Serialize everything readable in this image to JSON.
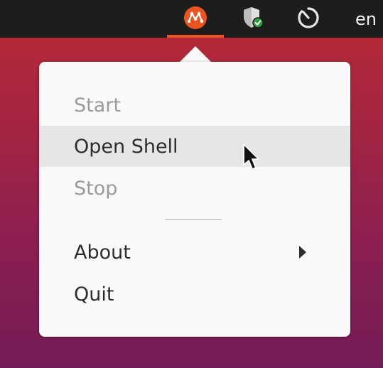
{
  "panel": {
    "indicators": [
      {
        "icon": "multipass-icon",
        "active": true,
        "accent": "#e95420"
      },
      {
        "icon": "shield-check-icon"
      },
      {
        "icon": "power-timer-icon"
      }
    ],
    "language": "en"
  },
  "menu": {
    "items": [
      {
        "label": "Start",
        "enabled": false
      },
      {
        "label": "Open Shell",
        "enabled": true,
        "hovered": true
      },
      {
        "label": "Stop",
        "enabled": false
      },
      {
        "label": "About",
        "enabled": true,
        "has_submenu": true
      },
      {
        "label": "Quit",
        "enabled": true
      }
    ]
  },
  "colors": {
    "panel_bg": "#1d1d1d",
    "accent": "#e95420",
    "menu_bg": "#f9f9f9",
    "hover_bg": "#e6e6e6",
    "text": "#2d2d2d",
    "disabled_text": "#9a9a9a"
  }
}
